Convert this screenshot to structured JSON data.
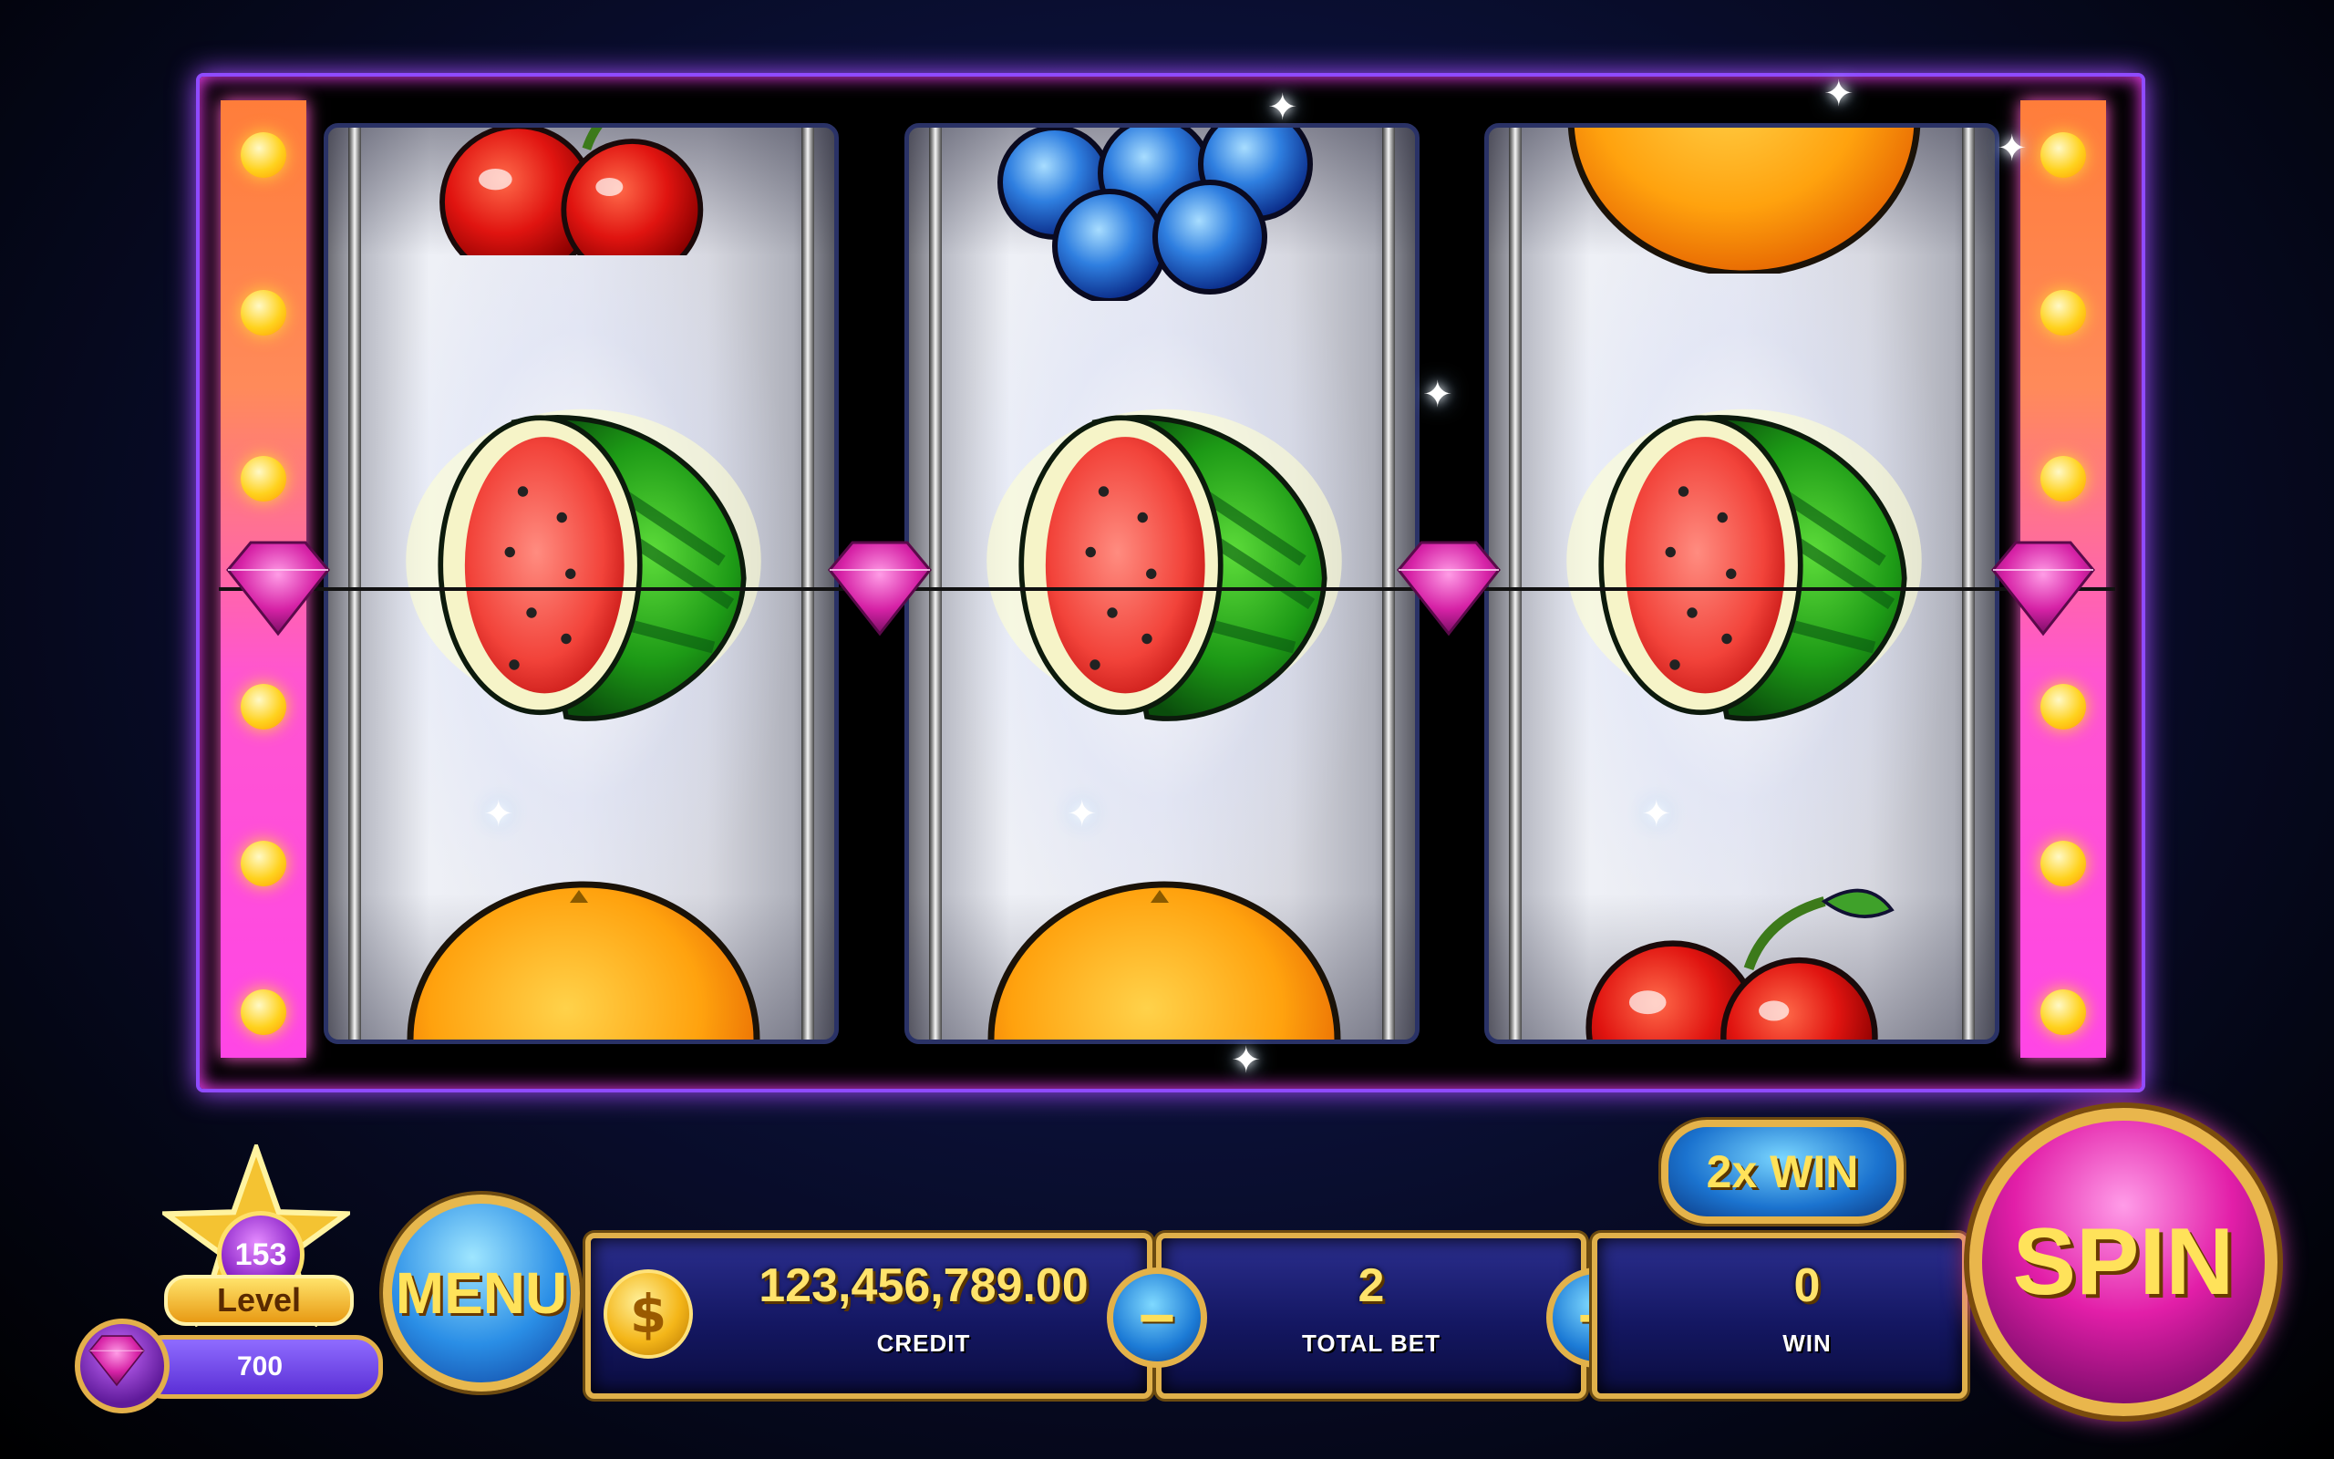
{
  "machine": {
    "reels": [
      {
        "top": "cherry",
        "middle": "watermelon",
        "bottom": "orange"
      },
      {
        "top": "grapes",
        "middle": "watermelon",
        "bottom": "orange"
      },
      {
        "top": "orange",
        "middle": "watermelon",
        "bottom": "cherry"
      }
    ],
    "payline_marker_icon": "diamond-gem-icon"
  },
  "hud": {
    "level": {
      "number": "153",
      "label": "Level"
    },
    "gems": {
      "value": "700"
    },
    "menu_label": "MENU",
    "credit": {
      "value": "123,456,789.00",
      "caption": "CREDIT",
      "icon": "dollar-coin-icon"
    },
    "total_bet": {
      "value": "2",
      "caption": "TOTAL BET"
    },
    "minus_label": "−",
    "plus_label": "+",
    "win": {
      "value": "0",
      "caption": "WIN"
    },
    "multiplier_badge": "2x WIN",
    "spin_label": "SPIN"
  },
  "colors": {
    "accent_gold": "#e8b44c",
    "spin_pink": "#e21ea8",
    "light_strip": "#ff46e6",
    "panel_blue": "#1b1e74"
  }
}
